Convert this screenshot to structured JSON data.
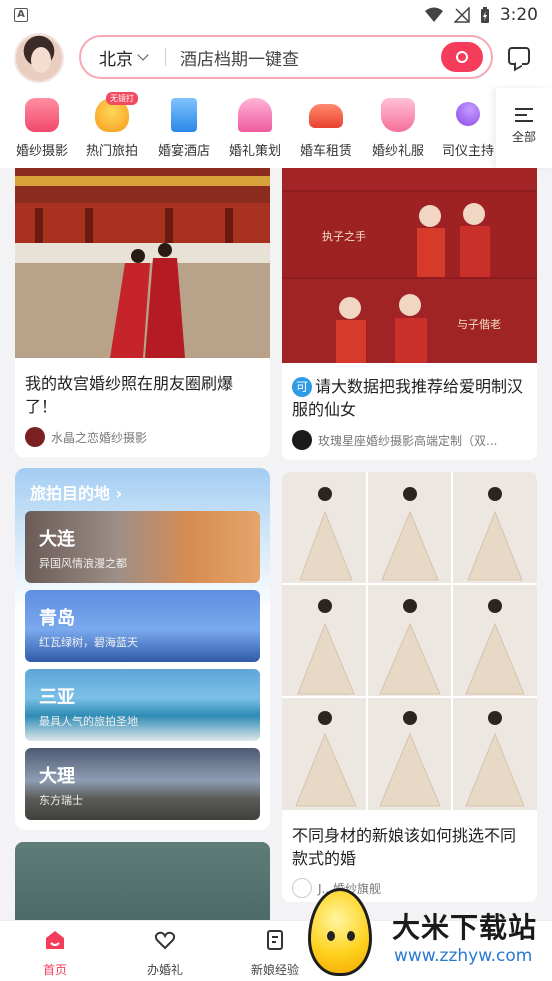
{
  "status": {
    "time": "3:20"
  },
  "header": {
    "city": "北京",
    "search_placeholder": "酒店档期一键查"
  },
  "categories": [
    {
      "label": "婚纱摄影",
      "icon": "camera-icon"
    },
    {
      "label": "热门旅拍",
      "icon": "hot-air-balloon-icon",
      "badge": "无镜打"
    },
    {
      "label": "婚宴酒店",
      "icon": "hotel-icon"
    },
    {
      "label": "婚礼策划",
      "icon": "arch-icon"
    },
    {
      "label": "婚车租赁",
      "icon": "car-icon"
    },
    {
      "label": "婚纱礼服",
      "icon": "dress-icon"
    },
    {
      "label": "司仪主持",
      "icon": "microphone-icon"
    }
  ],
  "categories_all": "全部",
  "feed": {
    "card1": {
      "title": "我的故宫婚纱照在朋友圈刷爆了！",
      "author": "水晶之恋婚纱摄影"
    },
    "card2": {
      "tag": "可",
      "title": "请大数据把我推荐给爱明制汉服的仙女",
      "author": "玫瑰星座婚纱摄影高端定制（双...",
      "photo_caption_1": "执子之手",
      "photo_caption_2": "与子偕老"
    },
    "card3": {
      "title": "不同身材的新娘该如何挑选不同款式的婚",
      "author": "J...婚纱旗舰"
    }
  },
  "destinations": {
    "title": "旅拍目的地 ›",
    "items": [
      {
        "name": "大连",
        "sub": "异国风情浪漫之都"
      },
      {
        "name": "青岛",
        "sub": "红瓦绿树，碧海蓝天"
      },
      {
        "name": "三亚",
        "sub": "最具人气的旅拍圣地"
      },
      {
        "name": "大理",
        "sub": "东方瑞士"
      }
    ]
  },
  "tabs": [
    {
      "label": "首页"
    },
    {
      "label": "办婚礼"
    },
    {
      "label": "新娘经验"
    }
  ],
  "watermark": {
    "title": "大米下载站",
    "url": "www.zzhyw.com"
  },
  "colors": {
    "accent": "#f53d5b",
    "search_border": "#f7a8b5",
    "link_blue": "#2a79d0"
  }
}
